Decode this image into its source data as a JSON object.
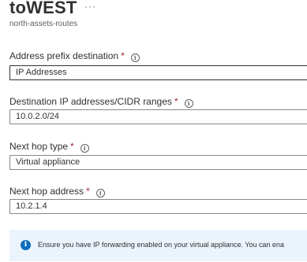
{
  "header": {
    "title": "toWEST",
    "more_label": "···",
    "subtitle": "north-assets-routes"
  },
  "form": {
    "address_prefix_destination": {
      "label": "Address prefix destination",
      "required_mark": "*",
      "info_glyph": "i",
      "value": "IP Addresses"
    },
    "destination_ip": {
      "label": "Destination IP addresses/CIDR ranges",
      "required_mark": "*",
      "info_glyph": "i",
      "value": "10.0.2.0/24"
    },
    "next_hop_type": {
      "label": "Next hop type",
      "required_mark": "*",
      "info_glyph": "i",
      "value": "Virtual appliance"
    },
    "next_hop_address": {
      "label": "Next hop address",
      "required_mark": "*",
      "info_glyph": "i",
      "value": "10.2.1.4"
    }
  },
  "notice": {
    "icon_glyph": "i",
    "text": "Ensure you have IP forwarding enabled on your virtual appliance. You can ena"
  },
  "colors": {
    "required": "#a4262c",
    "info_accent": "#0f6cbd",
    "notice_bg": "#ebf3fc"
  }
}
